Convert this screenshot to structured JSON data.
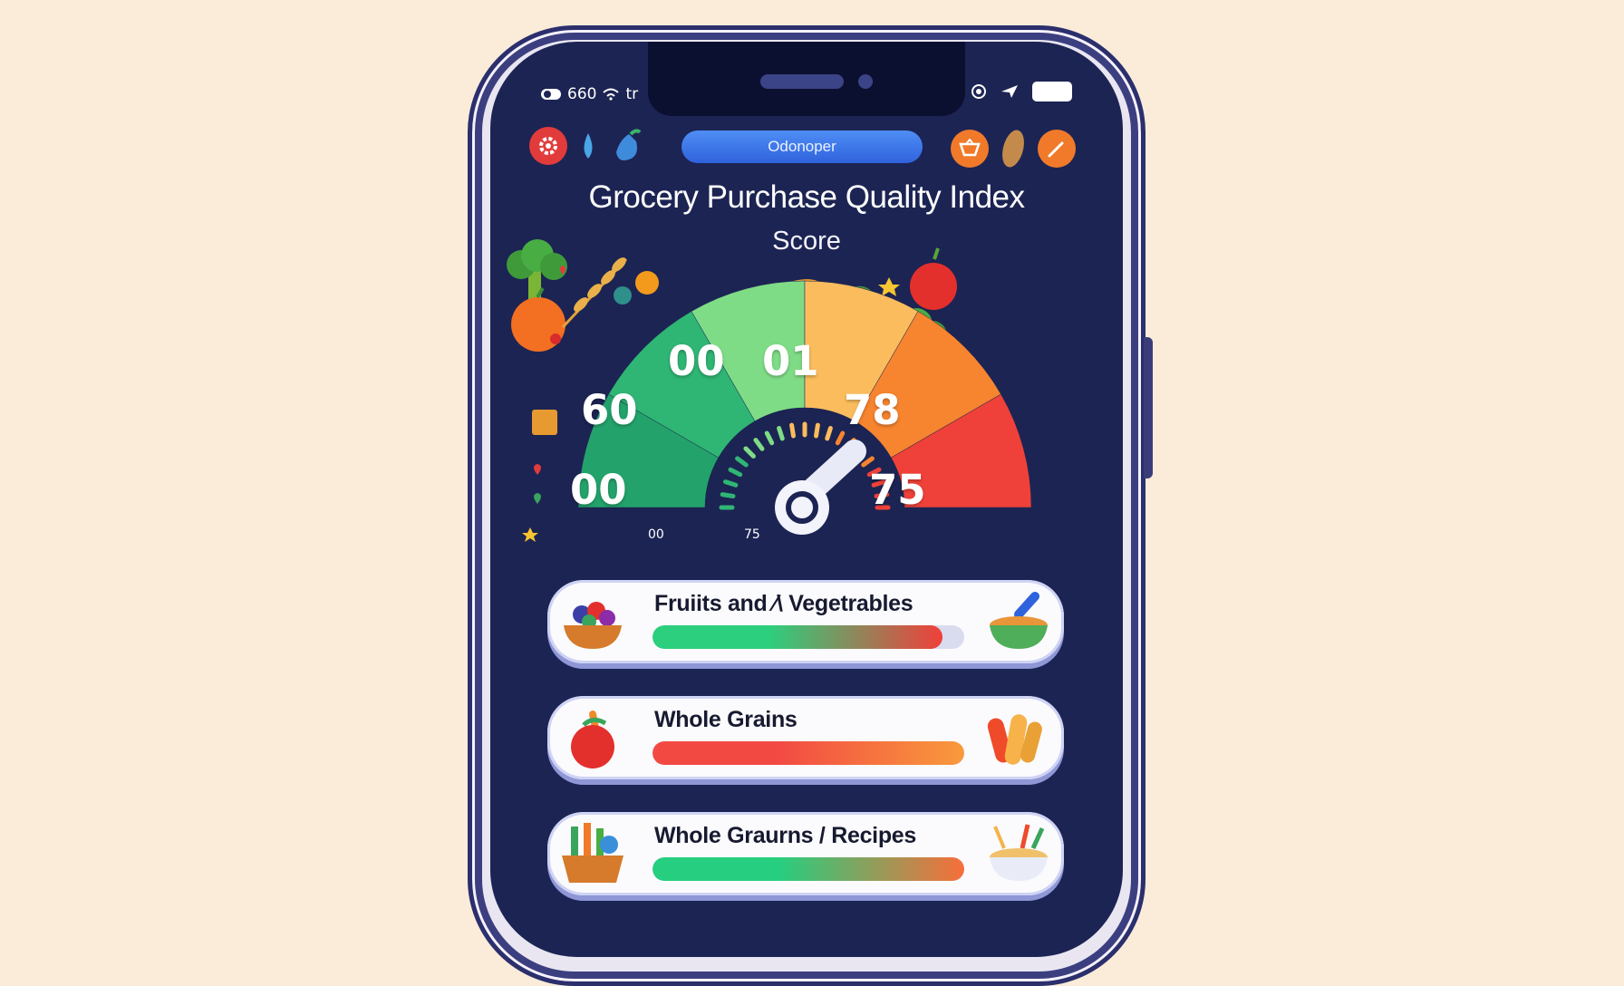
{
  "status_bar": {
    "left_text": "660",
    "left_extra": "tr"
  },
  "header": {
    "app_name": "Odonoper"
  },
  "title": "Grocery Purchase Quality Index",
  "subtitle": "Score",
  "gauge": {
    "segments": [
      {
        "label": "00",
        "color": "#23a36b"
      },
      {
        "label": "60",
        "color": "#2fb574"
      },
      {
        "label": "00",
        "color": "#7fdc86"
      },
      {
        "label": "01",
        "color": "#fbbc5e"
      },
      {
        "label": "78",
        "color": "#f7842f"
      },
      {
        "label": "75",
        "color": "#ef4139"
      }
    ],
    "dial_min_label": "00",
    "dial_max_label": "75"
  },
  "categories": [
    {
      "title": "Fruiits and ⁄\\ Vegetrables",
      "progress": 0.93,
      "gradient": [
        "#2ccf7d",
        "#f0403a"
      ],
      "icon_left": "fruit-bowl-icon",
      "icon_right": "lentil-bowl-icon"
    },
    {
      "title": "Whole Grains",
      "progress": 1.0,
      "gradient": [
        "#f24a43",
        "#f99a3c"
      ],
      "icon_left": "tomato-icon",
      "icon_right": "bread-icon"
    },
    {
      "title": "Whole Graurns / Recipes",
      "progress": 1.0,
      "gradient": [
        "#25cf7f",
        "#f76e3a"
      ],
      "icon_left": "vegetable-basket-icon",
      "icon_right": "noodle-bowl-icon"
    }
  ]
}
